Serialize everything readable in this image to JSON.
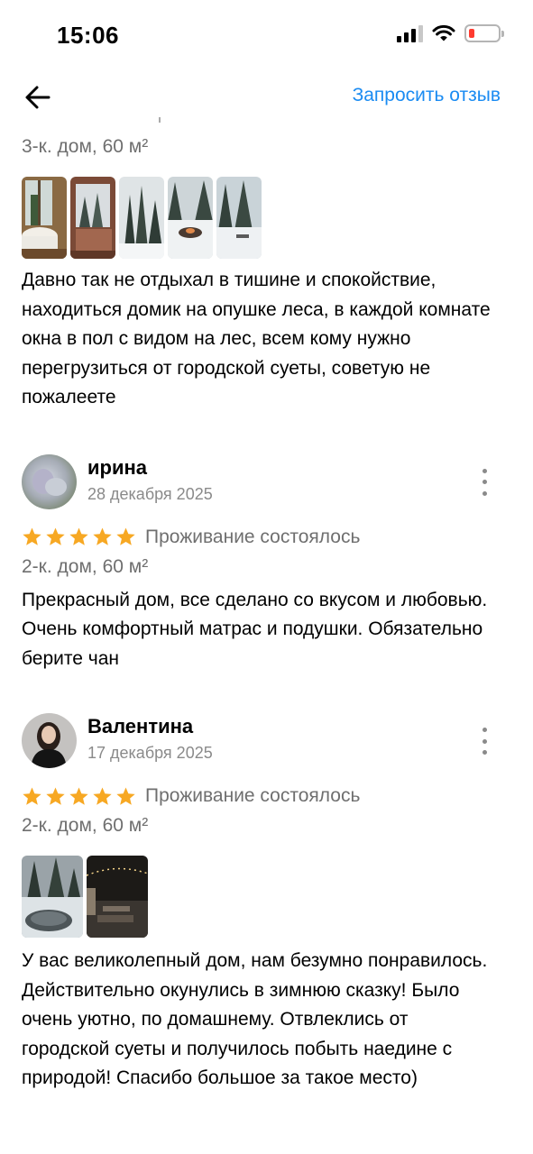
{
  "status": {
    "time": "15:06"
  },
  "nav": {
    "request_label": "Запросить отзыв"
  },
  "reviews": [
    {
      "apartment": "3-к. дом, 60 м²",
      "photos": [
        "bath-by-window",
        "forest-view-window",
        "snowy-forest",
        "fire-pit-snow",
        "yard-snow"
      ],
      "text": "Давно так не отдыхал в тишине и спокойствие, находиться домик на опушке леса, в каждой комнате окна в пол с видом на лес, всем кому нужно перегрузиться от городской суеты, советую не пожалеете"
    },
    {
      "author": "ирина",
      "date": "28 декабря 2025",
      "rating": 5,
      "stay_status": "Проживание состоялось",
      "apartment": "2-к. дом, 60 м²",
      "text": "Прекрасный дом, все сделано со вкусом и любовью. Очень комфортный матрас и подушки. Обязательно берите чан"
    },
    {
      "author": "Валентина",
      "date": "17 декабря 2025",
      "rating": 5,
      "stay_status": "Проживание состоялось",
      "apartment": "2-к. дом, 60 м²",
      "photos": [
        "hot-tub-snow",
        "garden-lights-night"
      ],
      "text": "У вас великолепный дом, нам безумно понравилось. Действительно окунулись в зимнюю сказку! Было очень уютно, по домашнему. Отвлеклись от городской суеты и получилось побыть наедине с природой! Спасибо большое за такое место)"
    }
  ],
  "colors": {
    "accent": "#1a8bf2",
    "star": "#f7a823",
    "secondary_text": "#6f6f6f"
  }
}
